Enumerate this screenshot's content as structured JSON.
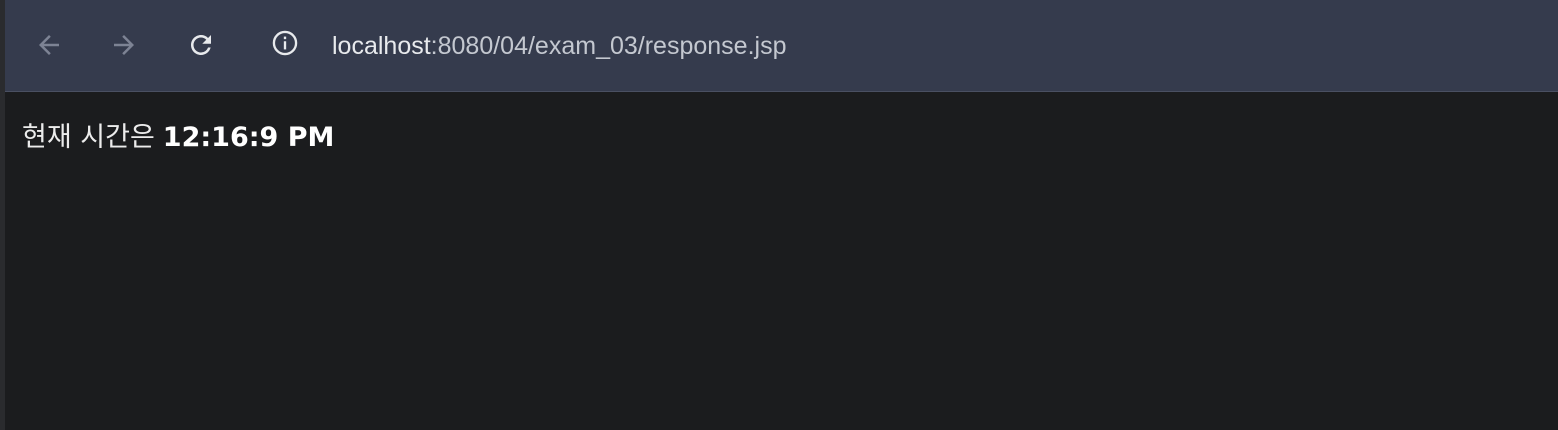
{
  "toolbar": {
    "back_icon": "arrow-left-icon",
    "forward_icon": "arrow-right-icon",
    "reload_icon": "reload-icon",
    "site_info_icon": "info-icon",
    "url_host": "localhost",
    "url_path": ":8080/04/exam_03/response.jsp"
  },
  "page": {
    "message_prefix": "현재 시간은",
    "time": "12:16:9 PM"
  },
  "colors": {
    "toolbar_bg": "#353b4d",
    "page_bg": "#1b1c1e",
    "icon_disabled": "#8a90a0",
    "icon_active": "#e8eaed"
  }
}
